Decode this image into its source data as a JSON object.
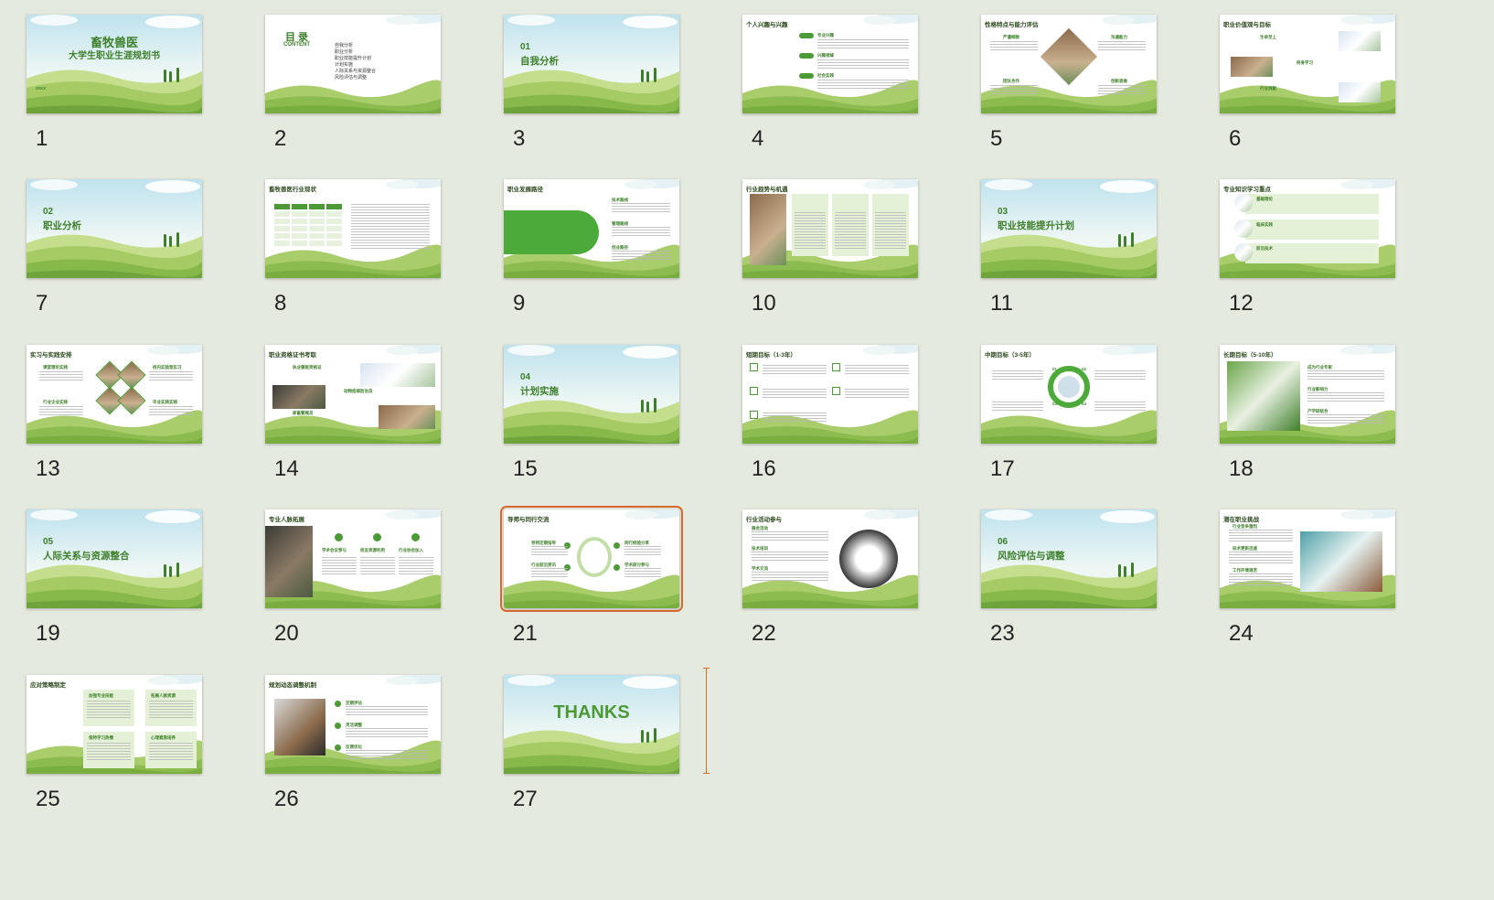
{
  "slides": [
    {
      "number": "1",
      "title": "畜牧兽医",
      "subtitle": "大学生职业生涯规划书",
      "footer": "20XX"
    },
    {
      "number": "2",
      "title": "目  录",
      "subtitle": "CONTENT",
      "items": [
        "自我分析",
        "职业分析",
        "职业技能提升计划",
        "计划实施",
        "人际关系与资源整合",
        "风险评估与调整"
      ]
    },
    {
      "number": "3",
      "section": "01",
      "title": "自我分析"
    },
    {
      "number": "4",
      "title": "个人兴趣与兴趣",
      "items": [
        "专业兴趣",
        "兴趣领域",
        "社会实践"
      ]
    },
    {
      "number": "5",
      "title": "性格特点与能力评估",
      "items": [
        "严谨细致",
        "沟通能力",
        "团队合作",
        "创新思维"
      ]
    },
    {
      "number": "6",
      "title": "职业价值观与目标",
      "items": [
        "生命至上",
        "终身学习",
        "行业贡献"
      ]
    },
    {
      "number": "7",
      "section": "02",
      "title": "职业分析"
    },
    {
      "number": "8",
      "title": "畜牧兽医行业现状"
    },
    {
      "number": "9",
      "title": "职业发展路径",
      "items": [
        "技术路线",
        "管理路线",
        "创业路径"
      ]
    },
    {
      "number": "10",
      "title": "行业趋势与机遇",
      "items": [
        "绿色养殖与可持续发展",
        "智能化养殖技术",
        "国际化合作与交流"
      ]
    },
    {
      "number": "11",
      "section": "03",
      "title": "职业技能提升计划"
    },
    {
      "number": "12",
      "title": "专业知识学习重点",
      "items": [
        "基础理论",
        "临床实践",
        "前沿技术"
      ]
    },
    {
      "number": "13",
      "title": "实习与实践安排",
      "items": [
        "课堂理论实践",
        "校内实验室实习",
        "行业企业实践",
        "毕业实践实践"
      ]
    },
    {
      "number": "14",
      "title": "职业资格证书考取",
      "items": [
        "执业兽医资格证",
        "动物疫病防治员",
        "家畜繁殖员"
      ]
    },
    {
      "number": "15",
      "section": "04",
      "title": "计划实施"
    },
    {
      "number": "16",
      "title": "短期目标（1-3年）"
    },
    {
      "number": "17",
      "title": "中期目标（3-5年）",
      "items": [
        "01",
        "02",
        "03",
        "04"
      ]
    },
    {
      "number": "18",
      "title": "长期目标（5-10年）",
      "items": [
        "成为行业专家",
        "行业影响力",
        "产学研结合"
      ]
    },
    {
      "number": "19",
      "section": "05",
      "title": "人际关系与资源整合"
    },
    {
      "number": "20",
      "title": "专业人脉拓展",
      "items": [
        "学术会议参与",
        "校友资源利用",
        "行业协会加入"
      ]
    },
    {
      "number": "21",
      "title": "导师与同行交流",
      "items": [
        "导师定期指导",
        "同行经验分享",
        "行业前沿资讯",
        "学术研讨参与"
      ]
    },
    {
      "number": "22",
      "title": "行业活动参与",
      "items": [
        "展会活动",
        "技术培训",
        "学术交流"
      ]
    },
    {
      "number": "23",
      "section": "06",
      "title": "风险评估与调整"
    },
    {
      "number": "24",
      "title": "潜在职业挑战",
      "items": [
        "行业竞争激烈",
        "技术更新迅速",
        "工作环境艰苦"
      ]
    },
    {
      "number": "25",
      "title": "应对策略制定",
      "items": [
        "加强专业技能",
        "拓展人脉资源",
        "保持学习热情",
        "心理素质培养"
      ]
    },
    {
      "number": "26",
      "title": "规划动态调整机制",
      "items": [
        "定期评估",
        "灵活调整",
        "反馈优化"
      ]
    },
    {
      "number": "27",
      "title": "THANKS"
    }
  ],
  "selected_slide": "21",
  "colors": {
    "accent_green": "#3d7f2a",
    "selection": "#d7692f",
    "background": "#e5eadf"
  }
}
